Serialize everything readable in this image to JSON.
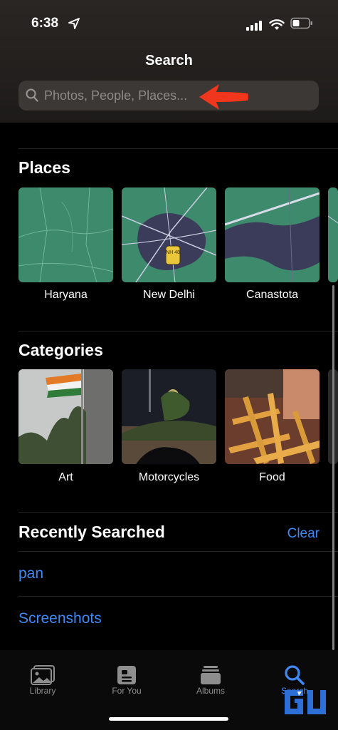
{
  "status": {
    "time": "6:38"
  },
  "header": {
    "title": "Search"
  },
  "search": {
    "placeholder": "Photos, People, Places..."
  },
  "places": {
    "heading": "Places",
    "items": [
      {
        "label": "Haryana"
      },
      {
        "label": "New Delhi",
        "badge": "NH 48"
      },
      {
        "label": "Canastota"
      }
    ]
  },
  "categories": {
    "heading": "Categories",
    "items": [
      {
        "label": "Art"
      },
      {
        "label": "Motorcycles"
      },
      {
        "label": "Food"
      }
    ]
  },
  "recent": {
    "heading": "Recently Searched",
    "clear_label": "Clear",
    "items": [
      "pan",
      "Screenshots"
    ]
  },
  "tabs": [
    {
      "label": "Library",
      "icon": "library-icon"
    },
    {
      "label": "For You",
      "icon": "for-you-icon"
    },
    {
      "label": "Albums",
      "icon": "albums-icon"
    },
    {
      "label": "Search",
      "icon": "search-tab-icon",
      "active": true
    }
  ],
  "watermark": "GU",
  "colors": {
    "accent": "#3d8af7",
    "arrow": "#f0361c",
    "map_green": "#3c8a6e"
  }
}
